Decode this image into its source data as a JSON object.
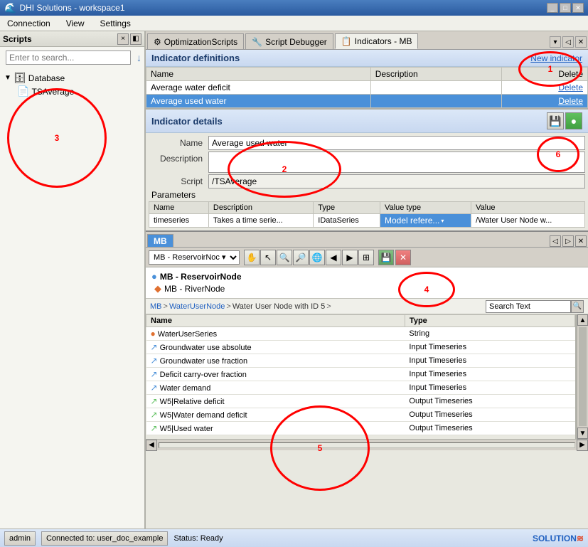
{
  "window": {
    "title": "DHI Solutions - workspace1"
  },
  "menu": {
    "items": [
      "Connection",
      "View",
      "Settings"
    ]
  },
  "scripts_panel": {
    "title": "Scripts",
    "search_placeholder": "Enter to search...",
    "tree": {
      "root": "Database",
      "children": [
        "TSAverage"
      ]
    }
  },
  "tabs": {
    "items": [
      {
        "label": "OptimizationScripts",
        "icon": "⚙"
      },
      {
        "label": "Script Debugger",
        "icon": "🔧"
      },
      {
        "label": "Indicators - MB",
        "icon": "📋",
        "active": true
      }
    ]
  },
  "indicator_definitions": {
    "title": "Indicator definitions",
    "new_indicator_label": "New indicator",
    "columns": [
      "Name",
      "Description",
      "Delete"
    ],
    "rows": [
      {
        "name": "Average water deficit",
        "description": "",
        "delete": "Delete"
      },
      {
        "name": "Average used water",
        "description": "",
        "delete": "Delete",
        "selected": true
      }
    ]
  },
  "indicator_details": {
    "title": "Indicator details",
    "fields": {
      "name_label": "Name",
      "name_value": "Average used water",
      "description_label": "Description",
      "description_value": "",
      "script_label": "Script",
      "script_value": "/TSAverage",
      "parameters_label": "Parameters"
    },
    "params_columns": [
      "Name",
      "Description",
      "Type",
      "Value type",
      "Value"
    ],
    "params_rows": [
      {
        "name": "timeseries",
        "description": "Takes a time serie...",
        "type": "IDataSeries",
        "value_type": "Model refere...",
        "value": "/Water User Node w..."
      }
    ]
  },
  "mb_panel": {
    "tab_label": "MB",
    "toolbar": {
      "select_value": "MB - ReservoirNoc ▾",
      "buttons": [
        "hand",
        "pointer",
        "zoom-in",
        "zoom-out",
        "globe",
        "back",
        "forward",
        "grid",
        "save",
        "close"
      ]
    },
    "tree": [
      {
        "label": "MB - ReservoirNode",
        "bold": true,
        "icon": "●"
      },
      {
        "label": "MB - RiverNode",
        "icon": "◆"
      }
    ],
    "breadcrumb": [
      "MB",
      "WaterUserNode",
      "Water User Node with ID 5"
    ],
    "search_placeholder": "Search Text",
    "columns": [
      "Name",
      "Type"
    ],
    "rows": [
      {
        "name": "WaterUserSeries",
        "type": "String",
        "icon": "●"
      },
      {
        "name": "Groundwater use absolute",
        "type": "Input Timeseries",
        "icon": "📈"
      },
      {
        "name": "Groundwater use fraction",
        "type": "Input Timeseries",
        "icon": "📈"
      },
      {
        "name": "Deficit carry-over fraction",
        "type": "Input Timeseries",
        "icon": "📈"
      },
      {
        "name": "Water demand",
        "type": "Input Timeseries",
        "icon": "📈"
      },
      {
        "name": "W5|Relative deficit",
        "type": "Output Timeseries",
        "icon": "📊"
      },
      {
        "name": "W5|Water demand deficit",
        "type": "Output Timeseries",
        "icon": "📊"
      },
      {
        "name": "W5|Used water",
        "type": "Output Timeseries",
        "icon": "📊"
      }
    ]
  },
  "status_bar": {
    "user": "admin",
    "connection": "Connected to: user_doc_example",
    "status": "Status: Ready",
    "logo": "SOLUTION"
  },
  "annotations": [
    {
      "id": "1",
      "label": "1"
    },
    {
      "id": "2",
      "label": "2"
    },
    {
      "id": "3",
      "label": "3"
    },
    {
      "id": "4",
      "label": "4"
    },
    {
      "id": "5",
      "label": "5"
    },
    {
      "id": "6",
      "label": "6"
    }
  ]
}
